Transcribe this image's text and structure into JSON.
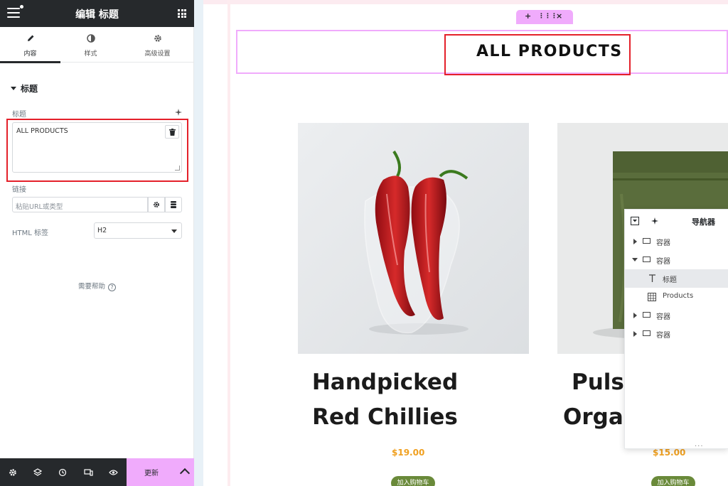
{
  "panel": {
    "header_title": "编辑 标题",
    "tabs": [
      {
        "label": "内容",
        "icon": "pencil-icon"
      },
      {
        "label": "样式",
        "icon": "half-circle-icon"
      },
      {
        "label": "高级设置",
        "icon": "gear-icon"
      }
    ],
    "section_title": "标题",
    "title_field": {
      "label": "标题",
      "value": "ALL PRODUCTS"
    },
    "link_field": {
      "label": "链接",
      "placeholder": "粘贴URL或类型"
    },
    "html_tag": {
      "label": "HTML 标签",
      "value": "H2"
    },
    "help_text": "需要帮助",
    "update_label": "更新"
  },
  "canvas": {
    "toolbar_icons": [
      "+",
      "⋮⋮⋮",
      "×"
    ],
    "heading": "ALL PRODUCTS",
    "products": [
      {
        "name_line1": "Handpicked",
        "name_line2": "Red Chillies",
        "price": "$19.00",
        "cart_label": "加入购物车"
      },
      {
        "name_line1": "Pulse",
        "name_line2": "Orga",
        "price": "$15.00",
        "cart_label": "加入购物车"
      }
    ]
  },
  "navigator": {
    "title": "导航器",
    "items": [
      {
        "label": "容器",
        "expand": "right"
      },
      {
        "label": "容器",
        "expand": "down"
      },
      {
        "label": "标题",
        "expand": "none",
        "icon": "text-icon"
      },
      {
        "label": "Products",
        "expand": "none",
        "icon": "grid-icon"
      },
      {
        "label": "容器",
        "expand": "right"
      },
      {
        "label": "容器",
        "expand": "right"
      }
    ],
    "more": "..."
  },
  "colors": {
    "panel_dark": "#26292c",
    "accent_pink": "#f0abfc",
    "highlight_red": "#e4202a",
    "price_orange": "#f0a020"
  }
}
